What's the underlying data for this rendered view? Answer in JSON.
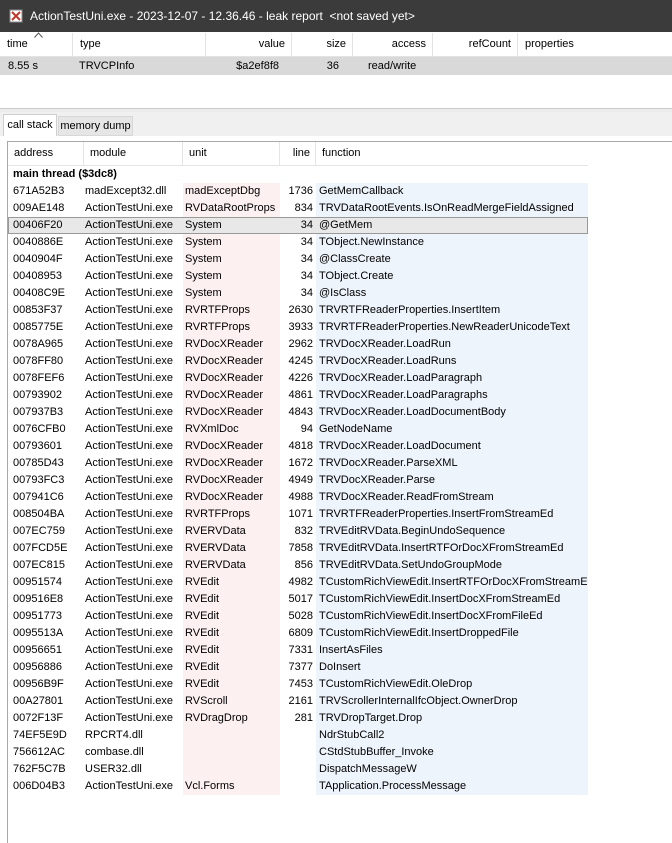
{
  "window": {
    "title": "ActionTestUni.exe - 2023-12-07 - 12.36.46 - leak report  <not saved yet>",
    "icon": "app-icon"
  },
  "leak_list": {
    "columns": [
      "time",
      "type",
      "value",
      "size",
      "access",
      "refCount",
      "properties"
    ],
    "sort_indicator": "chevron-up-icon",
    "rows": [
      {
        "time": "8.55 s",
        "type": "TRVCPInfo",
        "value": "$a2ef8f8",
        "size": "36",
        "access": "read/write",
        "refCount": "",
        "properties": ""
      }
    ]
  },
  "tabs": [
    "call stack",
    "memory dump"
  ],
  "active_tab": "call stack",
  "call_stack": {
    "columns": [
      "address",
      "module",
      "unit",
      "line",
      "function"
    ],
    "thread_label": "main thread ($3dc8)",
    "selected_index": 2,
    "colors": {
      "unit_bg": "#fdf0f0",
      "func_bg": "#eef4fc",
      "selected": "#e8e8e8"
    },
    "rows": [
      {
        "address": "671A52B3",
        "module": "madExcept32.dll",
        "unit": "madExceptDbg",
        "line": "1736",
        "function": "GetMemCallback"
      },
      {
        "address": "009AE148",
        "module": "ActionTestUni.exe",
        "unit": "RVDataRootProps",
        "line": "834",
        "function": "TRVDataRootEvents.IsOnReadMergeFieldAssigned"
      },
      {
        "address": "00406F20",
        "module": "ActionTestUni.exe",
        "unit": "System",
        "line": "34",
        "function": "@GetMem"
      },
      {
        "address": "0040886E",
        "module": "ActionTestUni.exe",
        "unit": "System",
        "line": "34",
        "function": "TObject.NewInstance"
      },
      {
        "address": "0040904F",
        "module": "ActionTestUni.exe",
        "unit": "System",
        "line": "34",
        "function": "@ClassCreate"
      },
      {
        "address": "00408953",
        "module": "ActionTestUni.exe",
        "unit": "System",
        "line": "34",
        "function": "TObject.Create"
      },
      {
        "address": "00408C9E",
        "module": "ActionTestUni.exe",
        "unit": "System",
        "line": "34",
        "function": "@IsClass"
      },
      {
        "address": "00853F37",
        "module": "ActionTestUni.exe",
        "unit": "RVRTFProps",
        "line": "2630",
        "function": "TRVRTFReaderProperties.InsertItem"
      },
      {
        "address": "0085775E",
        "module": "ActionTestUni.exe",
        "unit": "RVRTFProps",
        "line": "3933",
        "function": "TRVRTFReaderProperties.NewReaderUnicodeText"
      },
      {
        "address": "0078A965",
        "module": "ActionTestUni.exe",
        "unit": "RVDocXReader",
        "line": "2962",
        "function": "TRVDocXReader.LoadRun"
      },
      {
        "address": "0078FF80",
        "module": "ActionTestUni.exe",
        "unit": "RVDocXReader",
        "line": "4245",
        "function": "TRVDocXReader.LoadRuns"
      },
      {
        "address": "0078FEF6",
        "module": "ActionTestUni.exe",
        "unit": "RVDocXReader",
        "line": "4226",
        "function": "TRVDocXReader.LoadParagraph"
      },
      {
        "address": "00793902",
        "module": "ActionTestUni.exe",
        "unit": "RVDocXReader",
        "line": "4861",
        "function": "TRVDocXReader.LoadParagraphs"
      },
      {
        "address": "007937B3",
        "module": "ActionTestUni.exe",
        "unit": "RVDocXReader",
        "line": "4843",
        "function": "TRVDocXReader.LoadDocumentBody"
      },
      {
        "address": "0076CFB0",
        "module": "ActionTestUni.exe",
        "unit": "RVXmlDoc",
        "line": "94",
        "function": "GetNodeName"
      },
      {
        "address": "00793601",
        "module": "ActionTestUni.exe",
        "unit": "RVDocXReader",
        "line": "4818",
        "function": "TRVDocXReader.LoadDocument"
      },
      {
        "address": "00785D43",
        "module": "ActionTestUni.exe",
        "unit": "RVDocXReader",
        "line": "1672",
        "function": "TRVDocXReader.ParseXML"
      },
      {
        "address": "00793FC3",
        "module": "ActionTestUni.exe",
        "unit": "RVDocXReader",
        "line": "4949",
        "function": "TRVDocXReader.Parse"
      },
      {
        "address": "007941C6",
        "module": "ActionTestUni.exe",
        "unit": "RVDocXReader",
        "line": "4988",
        "function": "TRVDocXReader.ReadFromStream"
      },
      {
        "address": "008504BA",
        "module": "ActionTestUni.exe",
        "unit": "RVRTFProps",
        "line": "1071",
        "function": "TRVRTFReaderProperties.InsertFromStreamEd"
      },
      {
        "address": "007EC759",
        "module": "ActionTestUni.exe",
        "unit": "RVERVData",
        "line": "832",
        "function": "TRVEditRVData.BeginUndoSequence"
      },
      {
        "address": "007FCD5E",
        "module": "ActionTestUni.exe",
        "unit": "RVERVData",
        "line": "7858",
        "function": "TRVEditRVData.InsertRTFOrDocXFromStreamEd"
      },
      {
        "address": "007EC815",
        "module": "ActionTestUni.exe",
        "unit": "RVERVData",
        "line": "856",
        "function": "TRVEditRVData.SetUndoGroupMode"
      },
      {
        "address": "00951574",
        "module": "ActionTestUni.exe",
        "unit": "RVEdit",
        "line": "4982",
        "function": "TCustomRichViewEdit.InsertRTFOrDocXFromStreamEd"
      },
      {
        "address": "009516E8",
        "module": "ActionTestUni.exe",
        "unit": "RVEdit",
        "line": "5017",
        "function": "TCustomRichViewEdit.InsertDocXFromStreamEd"
      },
      {
        "address": "00951773",
        "module": "ActionTestUni.exe",
        "unit": "RVEdit",
        "line": "5028",
        "function": "TCustomRichViewEdit.InsertDocXFromFileEd"
      },
      {
        "address": "0095513A",
        "module": "ActionTestUni.exe",
        "unit": "RVEdit",
        "line": "6809",
        "function": "TCustomRichViewEdit.InsertDroppedFile"
      },
      {
        "address": "00956651",
        "module": "ActionTestUni.exe",
        "unit": "RVEdit",
        "line": "7331",
        "function": "InsertAsFiles"
      },
      {
        "address": "00956886",
        "module": "ActionTestUni.exe",
        "unit": "RVEdit",
        "line": "7377",
        "function": "DoInsert"
      },
      {
        "address": "00956B9F",
        "module": "ActionTestUni.exe",
        "unit": "RVEdit",
        "line": "7453",
        "function": "TCustomRichViewEdit.OleDrop"
      },
      {
        "address": "00A27801",
        "module": "ActionTestUni.exe",
        "unit": "RVScroll",
        "line": "2161",
        "function": "TRVScrollerInternalIfcObject.OwnerDrop"
      },
      {
        "address": "0072F13F",
        "module": "ActionTestUni.exe",
        "unit": "RVDragDrop",
        "line": "281",
        "function": "TRVDropTarget.Drop"
      },
      {
        "address": "74EF5E9D",
        "module": "RPCRT4.dll",
        "unit": "",
        "line": "",
        "function": "NdrStubCall2"
      },
      {
        "address": "756612AC",
        "module": "combase.dll",
        "unit": "",
        "line": "",
        "function": "CStdStubBuffer_Invoke"
      },
      {
        "address": "762F5C7B",
        "module": "USER32.dll",
        "unit": "",
        "line": "",
        "function": "DispatchMessageW"
      },
      {
        "address": "006D04B3",
        "module": "ActionTestUni.exe",
        "unit": "Vcl.Forms",
        "line": "",
        "function": "TApplication.ProcessMessage"
      }
    ]
  }
}
